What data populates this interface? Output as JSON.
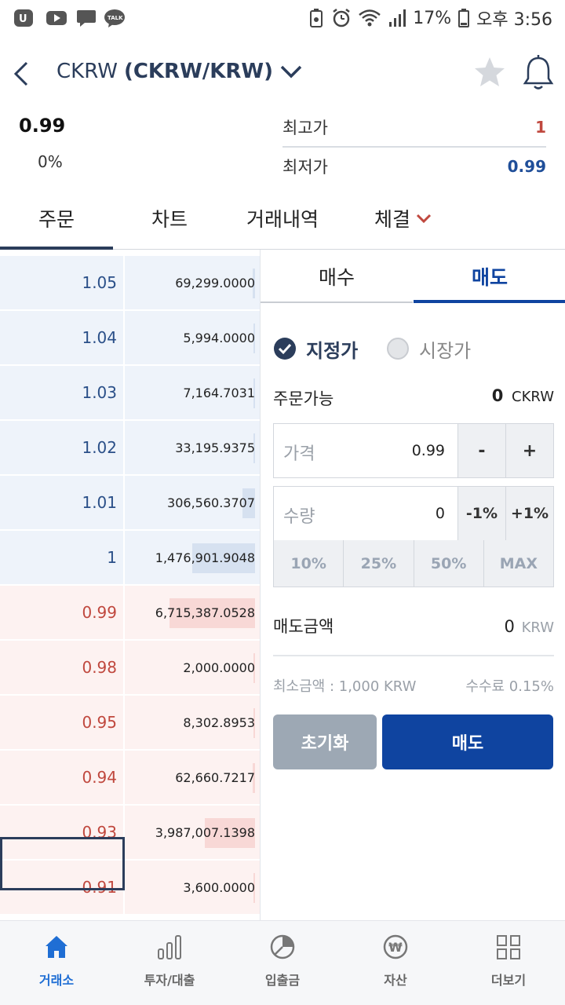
{
  "status_bar": {
    "battery": "17%",
    "time": "오후 3:56"
  },
  "header": {
    "symbol": "CKRW",
    "pair": "(CKRW/KRW)"
  },
  "price_info": {
    "price": "0.99",
    "change": "0%",
    "high_label": "최고가",
    "high_value": "1",
    "low_label": "최저가",
    "low_value": "0.99"
  },
  "tabs": [
    "주문",
    "차트",
    "거래내역",
    "체결"
  ],
  "orderbook": {
    "asks": [
      {
        "price": "1.05",
        "qty": "69,299.0000",
        "depth": 0.02
      },
      {
        "price": "1.04",
        "qty": "5,994.0000",
        "depth": 0.01
      },
      {
        "price": "1.03",
        "qty": "7,164.7031",
        "depth": 0.01
      },
      {
        "price": "1.02",
        "qty": "33,195.9375",
        "depth": 0.01
      },
      {
        "price": "1.01",
        "qty": "306,560.3707",
        "depth": 0.1
      },
      {
        "price": "1",
        "qty": "1,476,901.9048",
        "depth": 0.5
      }
    ],
    "bids": [
      {
        "price": "0.99",
        "qty": "6,715,387.0528",
        "depth": 0.68
      },
      {
        "price": "0.98",
        "qty": "2,000.0000",
        "depth": 0.01
      },
      {
        "price": "0.95",
        "qty": "8,302.8953",
        "depth": 0.01
      },
      {
        "price": "0.94",
        "qty": "62,660.7217",
        "depth": 0.02
      },
      {
        "price": "0.93",
        "qty": "3,987,007.1398",
        "depth": 0.4
      },
      {
        "price": "0.91",
        "qty": "3,600.0000",
        "depth": 0.01
      }
    ]
  },
  "order_panel": {
    "buy_tab": "매수",
    "sell_tab": "매도",
    "limit_label": "지정가",
    "market_label": "시장가",
    "available_label": "주문가능",
    "available_value": "0",
    "available_unit": "CKRW",
    "price_label": "가격",
    "price_value": "0.99",
    "minus": "-",
    "plus": "+",
    "qty_label": "수량",
    "qty_value": "0",
    "minus_pct": "-1%",
    "plus_pct": "+1%",
    "pct_buttons": [
      "10%",
      "25%",
      "50%",
      "MAX"
    ],
    "total_label": "매도금액",
    "total_value": "0",
    "total_unit": "KRW",
    "min_amount": "최소금액 : 1,000 KRW",
    "fee": "수수료 0.15%",
    "reset_button": "초기화",
    "sell_button": "매도",
    "colors": {
      "accent": "#0f44a0",
      "ask": "#2a4f88",
      "bid": "#c0483e"
    }
  },
  "bottom_nav": [
    {
      "label": "거래소",
      "icon": "home-icon",
      "active": true
    },
    {
      "label": "투자/대출",
      "icon": "bar-chart-icon",
      "active": false
    },
    {
      "label": "입출금",
      "icon": "pie-chart-icon",
      "active": false
    },
    {
      "label": "자산",
      "icon": "won-coin-icon",
      "active": false
    },
    {
      "label": "더보기",
      "icon": "grid-icon",
      "active": false
    }
  ]
}
